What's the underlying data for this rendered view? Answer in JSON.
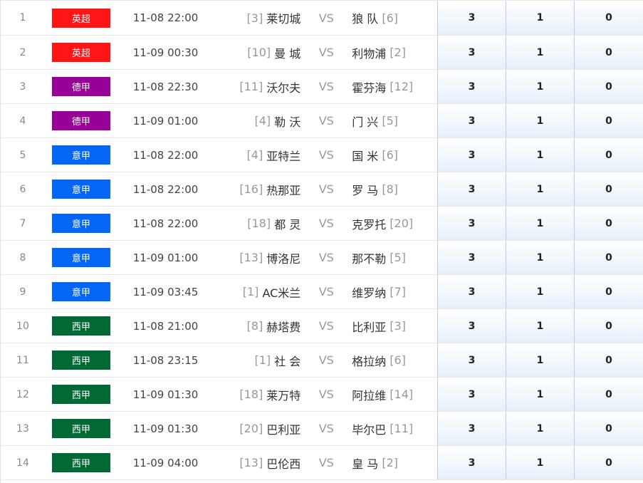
{
  "colors": {
    "英超": "#ff1515",
    "德甲": "#980098",
    "意甲": "#0466f4",
    "西甲": "#016935"
  },
  "separator": "VS",
  "rows": [
    {
      "idx": "1",
      "league": "英超",
      "time": "11-08 22:00",
      "home_rank": "[3]",
      "home": "莱切城",
      "away": "狼 队",
      "away_rank": "[6]",
      "s1": "3",
      "s2": "1",
      "s3": "0"
    },
    {
      "idx": "2",
      "league": "英超",
      "time": "11-09 00:30",
      "home_rank": "[10]",
      "home": "曼 城",
      "away": "利物浦",
      "away_rank": "[2]",
      "s1": "3",
      "s2": "1",
      "s3": "0"
    },
    {
      "idx": "3",
      "league": "德甲",
      "time": "11-08 22:30",
      "home_rank": "[11]",
      "home": "沃尔夫",
      "away": "霍芬海",
      "away_rank": "[12]",
      "s1": "3",
      "s2": "1",
      "s3": "0"
    },
    {
      "idx": "4",
      "league": "德甲",
      "time": "11-09 01:00",
      "home_rank": "[4]",
      "home": "勒 沃",
      "away": "门 兴",
      "away_rank": "[5]",
      "s1": "3",
      "s2": "1",
      "s3": "0"
    },
    {
      "idx": "5",
      "league": "意甲",
      "time": "11-08 22:00",
      "home_rank": "[4]",
      "home": "亚特兰",
      "away": "国 米",
      "away_rank": "[6]",
      "s1": "3",
      "s2": "1",
      "s3": "0"
    },
    {
      "idx": "6",
      "league": "意甲",
      "time": "11-08 22:00",
      "home_rank": "[16]",
      "home": "热那亚",
      "away": "罗 马",
      "away_rank": "[8]",
      "s1": "3",
      "s2": "1",
      "s3": "0"
    },
    {
      "idx": "7",
      "league": "意甲",
      "time": "11-08 22:00",
      "home_rank": "[18]",
      "home": "都 灵",
      "away": "克罗托",
      "away_rank": "[20]",
      "s1": "3",
      "s2": "1",
      "s3": "0"
    },
    {
      "idx": "8",
      "league": "意甲",
      "time": "11-09 01:00",
      "home_rank": "[13]",
      "home": "博洛尼",
      "away": "那不勒",
      "away_rank": "[5]",
      "s1": "3",
      "s2": "1",
      "s3": "0"
    },
    {
      "idx": "9",
      "league": "意甲",
      "time": "11-09 03:45",
      "home_rank": "[1]",
      "home": "AC米兰",
      "away": "维罗纳",
      "away_rank": "[7]",
      "s1": "3",
      "s2": "1",
      "s3": "0"
    },
    {
      "idx": "10",
      "league": "西甲",
      "time": "11-08 21:00",
      "home_rank": "[8]",
      "home": "赫塔费",
      "away": "比利亚",
      "away_rank": "[3]",
      "s1": "3",
      "s2": "1",
      "s3": "0"
    },
    {
      "idx": "11",
      "league": "西甲",
      "time": "11-08 23:15",
      "home_rank": "[1]",
      "home": "社 会",
      "away": "格拉纳",
      "away_rank": "[6]",
      "s1": "3",
      "s2": "1",
      "s3": "0"
    },
    {
      "idx": "12",
      "league": "西甲",
      "time": "11-09 01:30",
      "home_rank": "[18]",
      "home": "莱万特",
      "away": "阿拉维",
      "away_rank": "[14]",
      "s1": "3",
      "s2": "1",
      "s3": "0"
    },
    {
      "idx": "13",
      "league": "西甲",
      "time": "11-09 01:30",
      "home_rank": "[20]",
      "home": "巴利亚",
      "away": "毕尔巴",
      "away_rank": "[11]",
      "s1": "3",
      "s2": "1",
      "s3": "0"
    },
    {
      "idx": "14",
      "league": "西甲",
      "time": "11-09 04:00",
      "home_rank": "[13]",
      "home": "巴伦西",
      "away": "皇 马",
      "away_rank": "[2]",
      "s1": "3",
      "s2": "1",
      "s3": "0"
    }
  ]
}
